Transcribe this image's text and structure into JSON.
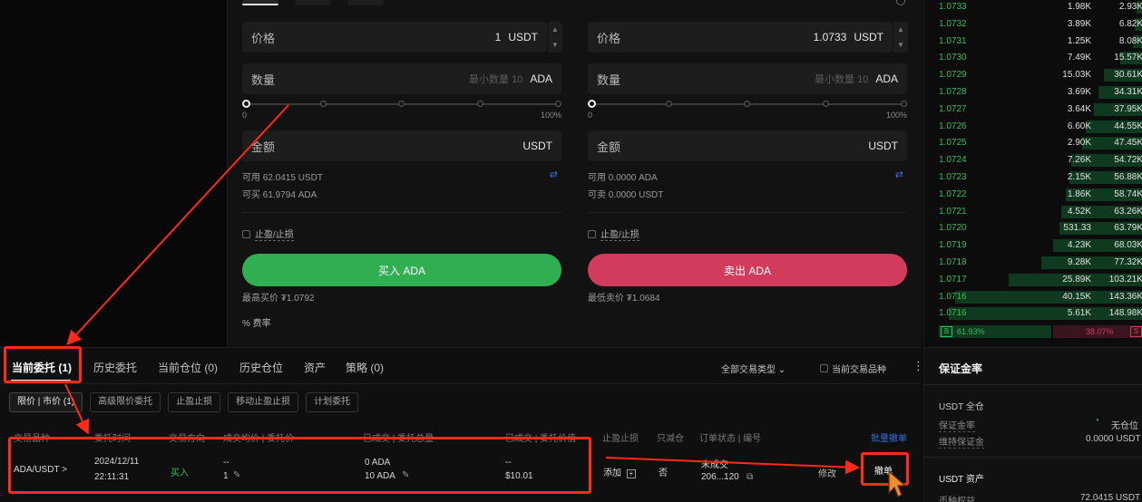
{
  "trade_form": {
    "buy": {
      "price_label": "价格",
      "price_value": "1",
      "price_unit": "USDT",
      "qty_label": "数量",
      "qty_placeholder": "最小数量 10",
      "qty_unit": "ADA",
      "slider_min": "0",
      "slider_max": "100%",
      "amount_label": "金额",
      "amount_unit": "USDT",
      "available": "可用 62.0415 USDT",
      "can_trade": "可买 61.9794 ADA",
      "tpsl_label": "止盈/止损",
      "button_label": "买入 ADA",
      "best_price": "最高买价 ₮1.0792"
    },
    "sell": {
      "price_label": "价格",
      "price_value": "1.0733",
      "price_unit": "USDT",
      "qty_label": "数量",
      "qty_placeholder": "最小数量 10",
      "qty_unit": "ADA",
      "slider_min": "0",
      "slider_max": "100%",
      "amount_label": "金额",
      "amount_unit": "USDT",
      "available": "可用 0.0000 ADA",
      "can_trade": "可卖 0.0000 USDT",
      "tpsl_label": "止盈/止损",
      "button_label": "卖出 ADA",
      "best_price": "最低卖价 ₮1.0684"
    },
    "fee_label": "% 费率",
    "buy_color": "#2fae52",
    "sell_color": "#d33b5d"
  },
  "orderbook": {
    "rows": [
      {
        "price": "1.0733",
        "amount": "1.98K",
        "total": "2.93K",
        "depth": 0.03
      },
      {
        "price": "1.0732",
        "amount": "3.89K",
        "total": "6.82K",
        "depth": 0.04
      },
      {
        "price": "1.0731",
        "amount": "1.25K",
        "total": "8.08K",
        "depth": 0.05
      },
      {
        "price": "1.0730",
        "amount": "7.49K",
        "total": "15.57K",
        "depth": 0.11
      },
      {
        "price": "1.0729",
        "amount": "15.03K",
        "total": "30.61K",
        "depth": 0.19
      },
      {
        "price": "1.0728",
        "amount": "3.69K",
        "total": "34.31K",
        "depth": 0.22
      },
      {
        "price": "1.0727",
        "amount": "3.64K",
        "total": "37.95K",
        "depth": 0.24
      },
      {
        "price": "1.0726",
        "amount": "6.60K",
        "total": "44.55K",
        "depth": 0.28
      },
      {
        "price": "1.0725",
        "amount": "2.90K",
        "total": "47.45K",
        "depth": 0.3
      },
      {
        "price": "1.0724",
        "amount": "7.26K",
        "total": "54.72K",
        "depth": 0.35
      },
      {
        "price": "1.0723",
        "amount": "2.15K",
        "total": "56.88K",
        "depth": 0.36
      },
      {
        "price": "1.0722",
        "amount": "1.86K",
        "total": "58.74K",
        "depth": 0.38
      },
      {
        "price": "1.0721",
        "amount": "4.52K",
        "total": "63.26K",
        "depth": 0.4
      },
      {
        "price": "1.0720",
        "amount": "531.33",
        "total": "63.79K",
        "depth": 0.41
      },
      {
        "price": "1.0719",
        "amount": "4.23K",
        "total": "68.03K",
        "depth": 0.44
      },
      {
        "price": "1.0718",
        "amount": "9.28K",
        "total": "77.32K",
        "depth": 0.5
      },
      {
        "price": "1.0717",
        "amount": "25.89K",
        "total": "103.21K",
        "depth": 0.66
      },
      {
        "price": "1.0716",
        "amount": "40.15K",
        "total": "143.36K",
        "depth": 0.92
      },
      {
        "price": "1.0716",
        "amount": "5.61K",
        "total": "148.98K",
        "depth": 0.95
      }
    ],
    "buy_badge": "B",
    "buy_ratio": "61.93%",
    "sell_ratio": "38.07%",
    "sell_badge": "S",
    "price_color": "#2fbf5a"
  },
  "bottom": {
    "tabs": [
      "当前委托 (1)",
      "历史委托",
      "当前仓位 (0)",
      "历史仓位",
      "资产",
      "策略 (0)"
    ],
    "filter_type": "全部交易类型",
    "filter_current": "当前交易品种",
    "sub_tabs": [
      "限价 | 市价 (1)",
      "高级限价委托",
      "止盈止损",
      "移动止盈止损",
      "计划委托"
    ],
    "headers": [
      "交易品种",
      "委托时间",
      "交易方向",
      "成交均价 | 委托价",
      "已成交 | 委托总量",
      "已成交 | 委托价值",
      "止盈止损",
      "只减仓",
      "订单状态 | 编号"
    ],
    "batch_cancel": "批量撤单",
    "order": {
      "symbol": "ADA/USDT >",
      "date": "2024/12/11",
      "time": "22:11:31",
      "side": "买入",
      "avg_price": "--",
      "order_price": "1",
      "filled": "0 ADA",
      "total": "10 ADA",
      "filled_value": "--",
      "order_value": "$10.01",
      "tpsl": "添加",
      "reduce_only": "否",
      "status": "未成交",
      "order_id": "206...120",
      "modify": "修改",
      "cancel": "撤单"
    }
  },
  "margin": {
    "title": "保证金率",
    "usdt_all": "USDT 全仓",
    "margin_rate": "保证金率",
    "maintain": "维持保证金",
    "no_position": "无仓位",
    "maintain_value": "0.0000 USDT",
    "usdt_assets": "USDT 资产",
    "equity_label": "币种权益",
    "equity_value": "72.0415 USDT"
  },
  "annotation_color": "#ff2a1a"
}
